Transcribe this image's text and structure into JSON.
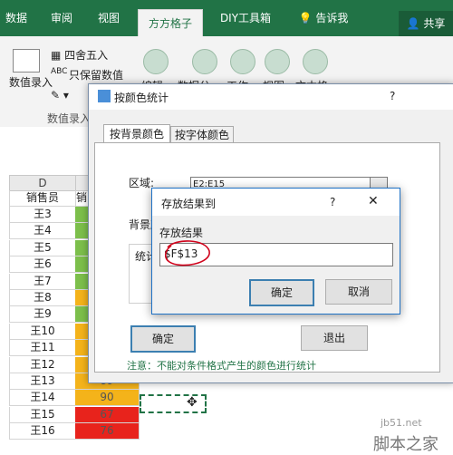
{
  "ribbon": {
    "tabs": [
      "数据",
      "审阅",
      "视图",
      "方方格子",
      "DIY工具箱"
    ],
    "active_tab": "方方格子",
    "tell_me": "告诉我",
    "share": "共享",
    "round_label": "四舍五入",
    "keep_values_label": "只保留数值",
    "abc_label": "ABC",
    "data_entry_label": "数值录入",
    "gallery_labels": [
      "编辑",
      "数据分",
      "工作",
      "视图",
      "文本格"
    ],
    "group_label": "数值录入"
  },
  "sheet": {
    "col_d_header": "D",
    "col_e_header": "销",
    "header_cell": "销售员",
    "rows": [
      {
        "name": "王3",
        "value": "",
        "color": "#7cbf4b"
      },
      {
        "name": "王4",
        "value": "",
        "color": "#7cbf4b"
      },
      {
        "name": "王5",
        "value": "",
        "color": "#7cbf4b"
      },
      {
        "name": "王6",
        "value": "",
        "color": "#7cbf4b"
      },
      {
        "name": "王7",
        "value": "",
        "color": "#7cbf4b"
      },
      {
        "name": "王8",
        "value": "",
        "color": "#f4b31a"
      },
      {
        "name": "王9",
        "value": "",
        "color": "#7cbf4b"
      },
      {
        "name": "王10",
        "value": "",
        "color": "#f4b31a"
      },
      {
        "name": "王11",
        "value": "",
        "color": "#f4b31a"
      },
      {
        "name": "王12",
        "value": "",
        "color": "#f4b31a"
      },
      {
        "name": "王13",
        "value": "89",
        "color": "#f4b31a"
      },
      {
        "name": "王14",
        "value": "90",
        "color": "#f4b31a"
      },
      {
        "name": "王15",
        "value": "67",
        "color": "#e8231c"
      },
      {
        "name": "王16",
        "value": "76",
        "color": "#e8231c"
      }
    ]
  },
  "dialog": {
    "title": "按颜色统计",
    "help": "?",
    "tab_bg": "按背景颜色",
    "tab_font": "按字体颜色",
    "range_label": "区域:",
    "range_value": "E2:E15",
    "bg_label": "背景颜",
    "stat_label": "统计",
    "ok": "确定",
    "exit": "退出",
    "note": "注意：不能对条件格式产生的颜色进行统计"
  },
  "dialog2": {
    "title": "存放结果到",
    "help": "?",
    "close": "✕",
    "field_label": "存放结果",
    "field_value": "$F$13",
    "ok": "确定",
    "cancel": "取消"
  },
  "watermark": {
    "site": "jb51.net",
    "brand": "脚本之家"
  }
}
